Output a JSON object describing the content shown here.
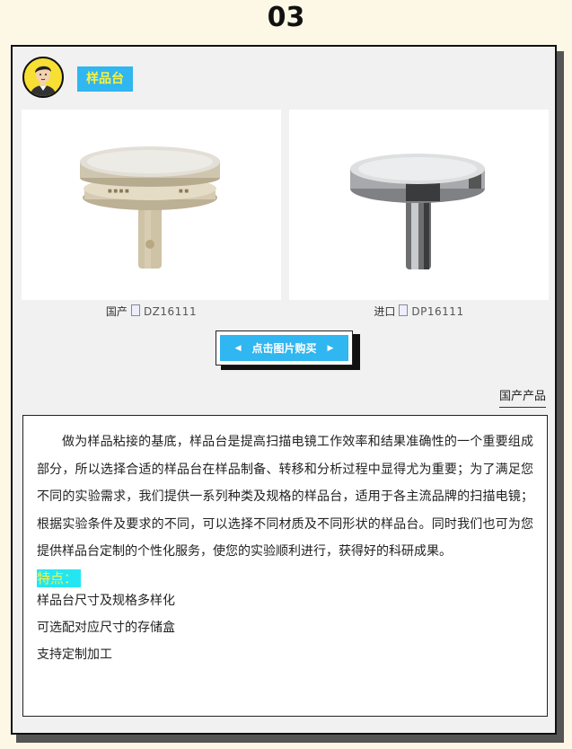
{
  "section_number": "03",
  "title_tag": "样品台",
  "products": [
    {
      "origin": "国产",
      "code": "DZ16111"
    },
    {
      "origin": "进口",
      "code": "DP16111"
    }
  ],
  "buy_button": {
    "label": "点击图片购买",
    "left_arrow": "◀",
    "right_arrow": "▶"
  },
  "sub_heading": "国产产品",
  "description": "做为样品粘接的基底，样品台是提高扫描电镜工作效率和结果准确性的一个重要组成部分，所以选择合适的样品台在样品制备、转移和分析过程中显得尤为重要；为了满足您不同的实验需求，我们提供一系列种类及规格的样品台，适用于各主流品牌的扫描电镜；根据实验条件及要求的不同，可以选择不同材质及不同形状的样品台。同时我们也可为您提供样品台定制的个性化服务，使您的实验顺利进行，获得好的科研成果。",
  "features_label": "特点：",
  "features": [
    "样品台尺寸及规格多样化",
    "可选配对应尺寸的存储盒",
    "支持定制加工"
  ]
}
